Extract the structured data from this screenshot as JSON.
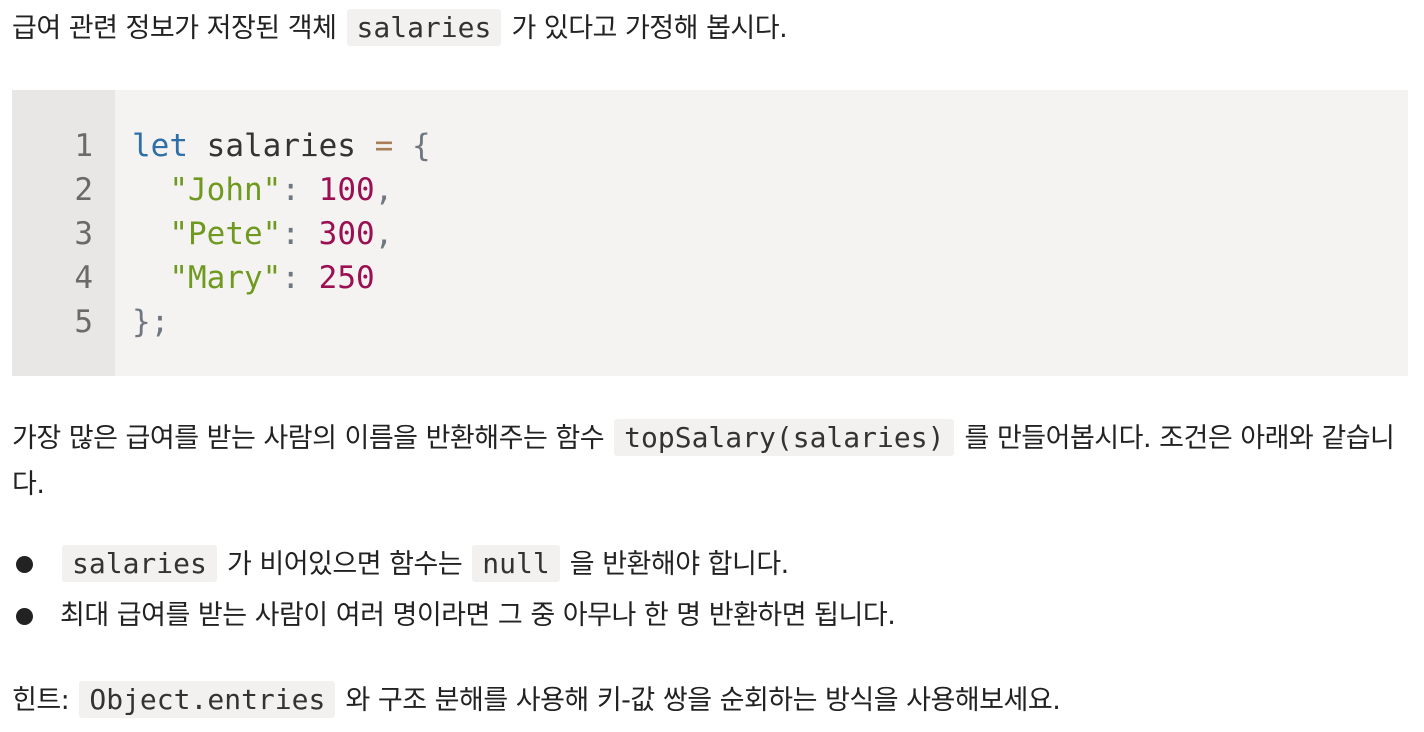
{
  "intro": {
    "before": "급여 관련 정보가 저장된 객체 ",
    "code": "salaries",
    "after": " 가 있다고 가정해 봅시다."
  },
  "code_block": {
    "line_numbers": [
      "1",
      "2",
      "3",
      "4",
      "5"
    ],
    "lines": [
      [
        {
          "t": "let",
          "c": "kw"
        },
        {
          "t": " salaries ",
          "c": ""
        },
        {
          "t": "=",
          "c": "op"
        },
        {
          "t": " ",
          "c": ""
        },
        {
          "t": "{",
          "c": "punc"
        }
      ],
      [
        {
          "t": "  ",
          "c": ""
        },
        {
          "t": "\"John\"",
          "c": "str"
        },
        {
          "t": ":",
          "c": "punc"
        },
        {
          "t": " ",
          "c": ""
        },
        {
          "t": "100",
          "c": "num"
        },
        {
          "t": ",",
          "c": "punc"
        }
      ],
      [
        {
          "t": "  ",
          "c": ""
        },
        {
          "t": "\"Pete\"",
          "c": "str"
        },
        {
          "t": ":",
          "c": "punc"
        },
        {
          "t": " ",
          "c": ""
        },
        {
          "t": "300",
          "c": "num"
        },
        {
          "t": ",",
          "c": "punc"
        }
      ],
      [
        {
          "t": "  ",
          "c": ""
        },
        {
          "t": "\"Mary\"",
          "c": "str"
        },
        {
          "t": ":",
          "c": "punc"
        },
        {
          "t": " ",
          "c": ""
        },
        {
          "t": "250",
          "c": "num"
        }
      ],
      [
        {
          "t": "}",
          "c": "punc"
        },
        {
          "t": ";",
          "c": "punc"
        }
      ]
    ]
  },
  "task": {
    "before": "가장 많은 급여를 받는 사람의 이름을 반환해주는 함수 ",
    "code": "topSalary(salaries)",
    "after": " 를 만들어봅시다. 조건은 아래와 같습니다."
  },
  "conditions": [
    {
      "before": "",
      "code": "salaries",
      "mid": " 가 비어있으면 함수는 ",
      "code2": "null",
      "after": " 을 반환해야 합니다."
    },
    {
      "before": "최대 급여를 받는 사람이 여러 명이라면 그 중 아무나 한 명 반환하면 됩니다."
    }
  ],
  "hint": {
    "before": "힌트: ",
    "code": "Object.entries",
    "after": " 와 구조 분해를 사용해 키-값 쌍을 순회하는 방식을 사용해보세요."
  }
}
